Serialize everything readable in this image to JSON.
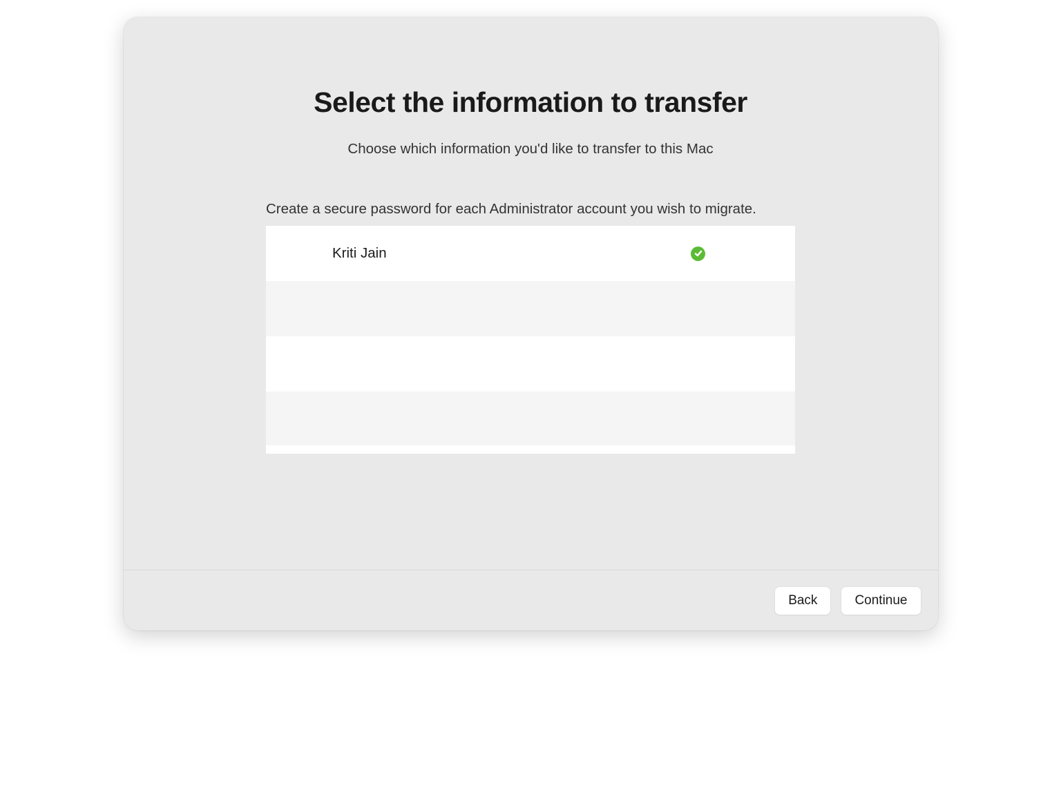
{
  "header": {
    "title": "Select the information to transfer",
    "subtitle": "Choose which information you'd like to transfer to this Mac"
  },
  "instruction": "Create a secure password for each Administrator account you wish to migrate.",
  "accounts": [
    {
      "name": "Kriti Jain",
      "verified": true
    }
  ],
  "footer": {
    "back_label": "Back",
    "continue_label": "Continue"
  }
}
